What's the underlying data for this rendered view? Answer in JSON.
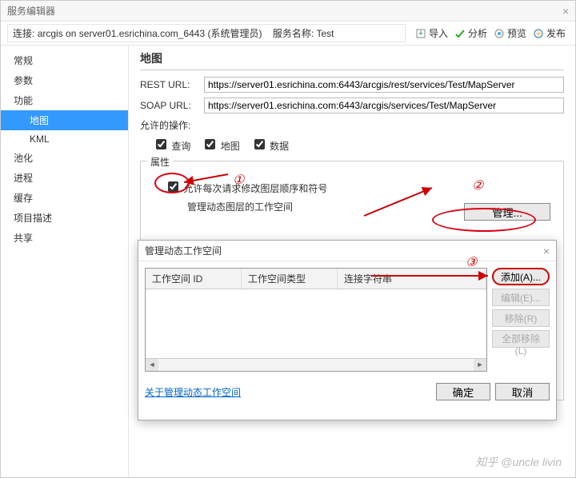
{
  "window": {
    "title": "服务编辑器"
  },
  "connection": {
    "label_prefix": "连接:",
    "conn_text": "arcgis on server01.esrichina.com_6443 (系统管理员)",
    "svc_label": "服务名称:",
    "svc_name": "Test"
  },
  "toolbar": {
    "import": "导入",
    "analyze": "分析",
    "preview": "预览",
    "publish": "发布"
  },
  "sidebar": {
    "items": [
      "常规",
      "参数",
      "功能",
      "地图",
      "KML",
      "池化",
      "进程",
      "缓存",
      "项目描述",
      "共享"
    ],
    "selected": "地图"
  },
  "main": {
    "heading": "地图",
    "rest_label": "REST URL:",
    "rest_url": "https://server01.esrichina.com:6443/arcgis/rest/services/Test/MapServer",
    "soap_label": "SOAP URL:",
    "soap_url": "https://server01.esrichina.com:6443/arcgis/services/Test/MapServer",
    "allowed_ops_label": "允许的操作:",
    "ops": {
      "query": "查询",
      "map": "地图",
      "data": "数据"
    },
    "props": {
      "legend": "属性",
      "allow_per_request": "允许每次请求修改图层顺序和符号",
      "manage_desc": "管理动态图层的工作空间",
      "manage_btn": "管理..."
    }
  },
  "dialog": {
    "title": "管理动态工作空间",
    "columns": {
      "id": "工作空间 ID",
      "type": "工作空间类型",
      "conn": "连接字符串"
    },
    "buttons": {
      "add": "添加(A)...",
      "edit": "编辑(E)...",
      "remove": "移除(R)",
      "remove_all": "全部移除(L)"
    },
    "help_link": "关于管理动态工作空间",
    "ok": "确定",
    "cancel": "取消"
  },
  "annotations": {
    "a1": "①",
    "a2": "②",
    "a3": "③"
  },
  "watermark": "知乎 @uncle livin"
}
